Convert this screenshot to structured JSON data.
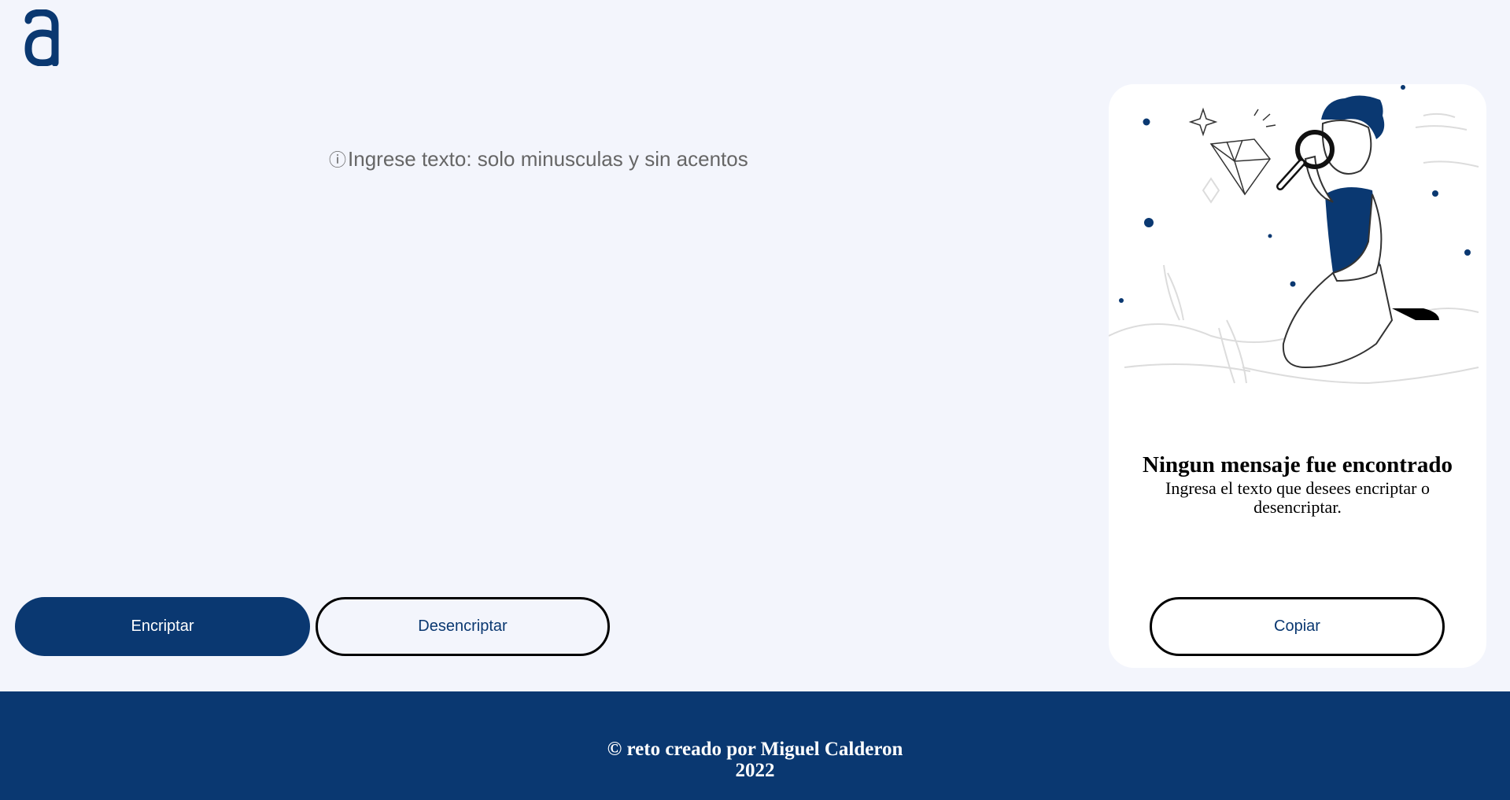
{
  "header": {
    "logo_icon": "alura-a-logo-icon"
  },
  "input": {
    "info_icon": "info-circle-icon",
    "info_glyph": "ⓘ",
    "hint_text": "Ingrese texto: solo minusculas y sin acentos",
    "value": ""
  },
  "actions": {
    "encrypt_label": "Encriptar",
    "decrypt_label": "Desencriptar"
  },
  "output": {
    "illustration_icon": "boy-with-magnifying-glass-illustration",
    "title": "Ningun mensaje fue encontrado",
    "subtitle": "Ingresa el texto que desees encriptar o desencriptar.",
    "copy_label": "Copiar"
  },
  "footer": {
    "credit": "© reto creado por Miguel Calderon",
    "year": "2022"
  },
  "colors": {
    "primary": "#0a3871",
    "background": "#f3f5fc",
    "card": "#ffffff"
  }
}
